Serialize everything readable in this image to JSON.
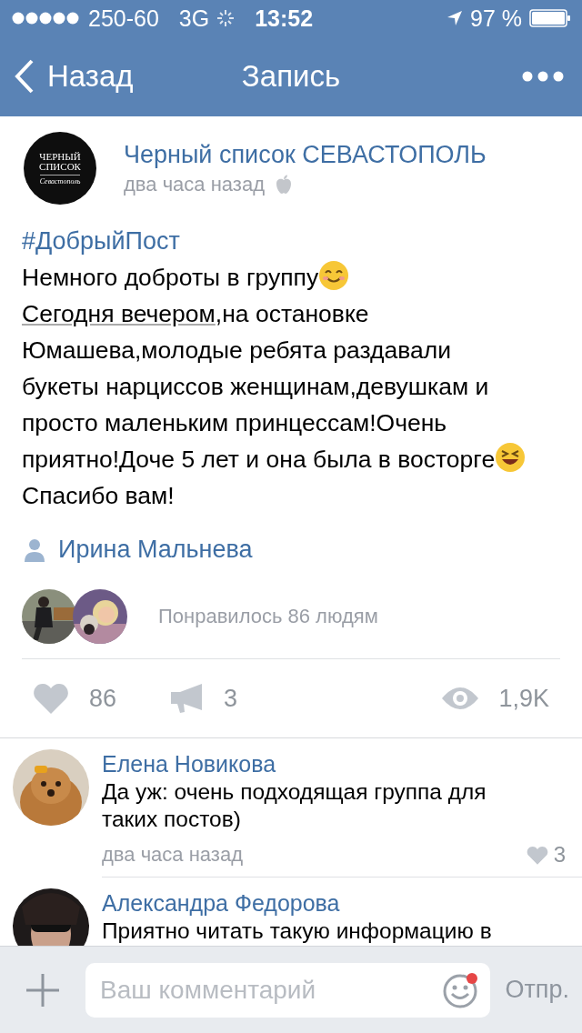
{
  "status_bar": {
    "carrier": "250-60",
    "network": "3G",
    "time": "13:52",
    "battery": "97 %"
  },
  "nav": {
    "back": "Назад",
    "title": "Запись"
  },
  "post": {
    "group": {
      "name": "Черный список СЕВАСТОПОЛЬ",
      "logo_lines": [
        "ЧЕРНЫЙ",
        "СПИСОК",
        "Севастополь"
      ],
      "time": "два часа назад"
    },
    "hashtag": "#ДобрыйПост",
    "body": [
      {
        "kind": "text",
        "text": "Немного доброты в группу"
      },
      {
        "kind": "smile"
      },
      {
        "kind": "date",
        "text": "Сегодня вечером"
      },
      {
        "kind": "text",
        "text": ",на остановке Юмашева,молодые ребята раздавали букеты нарциссов женщинам,девушкам и просто маленьким принцессам!Очень приятно!Доче 5 лет и она была в восторге"
      },
      {
        "kind": "laugh"
      },
      {
        "kind": "text",
        "text": " Спасибо вам!"
      }
    ],
    "author": "Ирина Мальнева",
    "likes_summary": "Понравилось 86 людям",
    "stats": {
      "likes": "86",
      "reposts": "3",
      "views": "1,9K"
    }
  },
  "comments": [
    {
      "name": "Елена Новикова",
      "text": "Да уж: очень подходящая группа для таких постов)",
      "time": "два часа назад",
      "likes": "3"
    },
    {
      "name": "Александра Федорова",
      "text": "Приятно читать такую информацию в"
    }
  ],
  "composer": {
    "placeholder": "Ваш комментарий",
    "send": "Отпр."
  }
}
